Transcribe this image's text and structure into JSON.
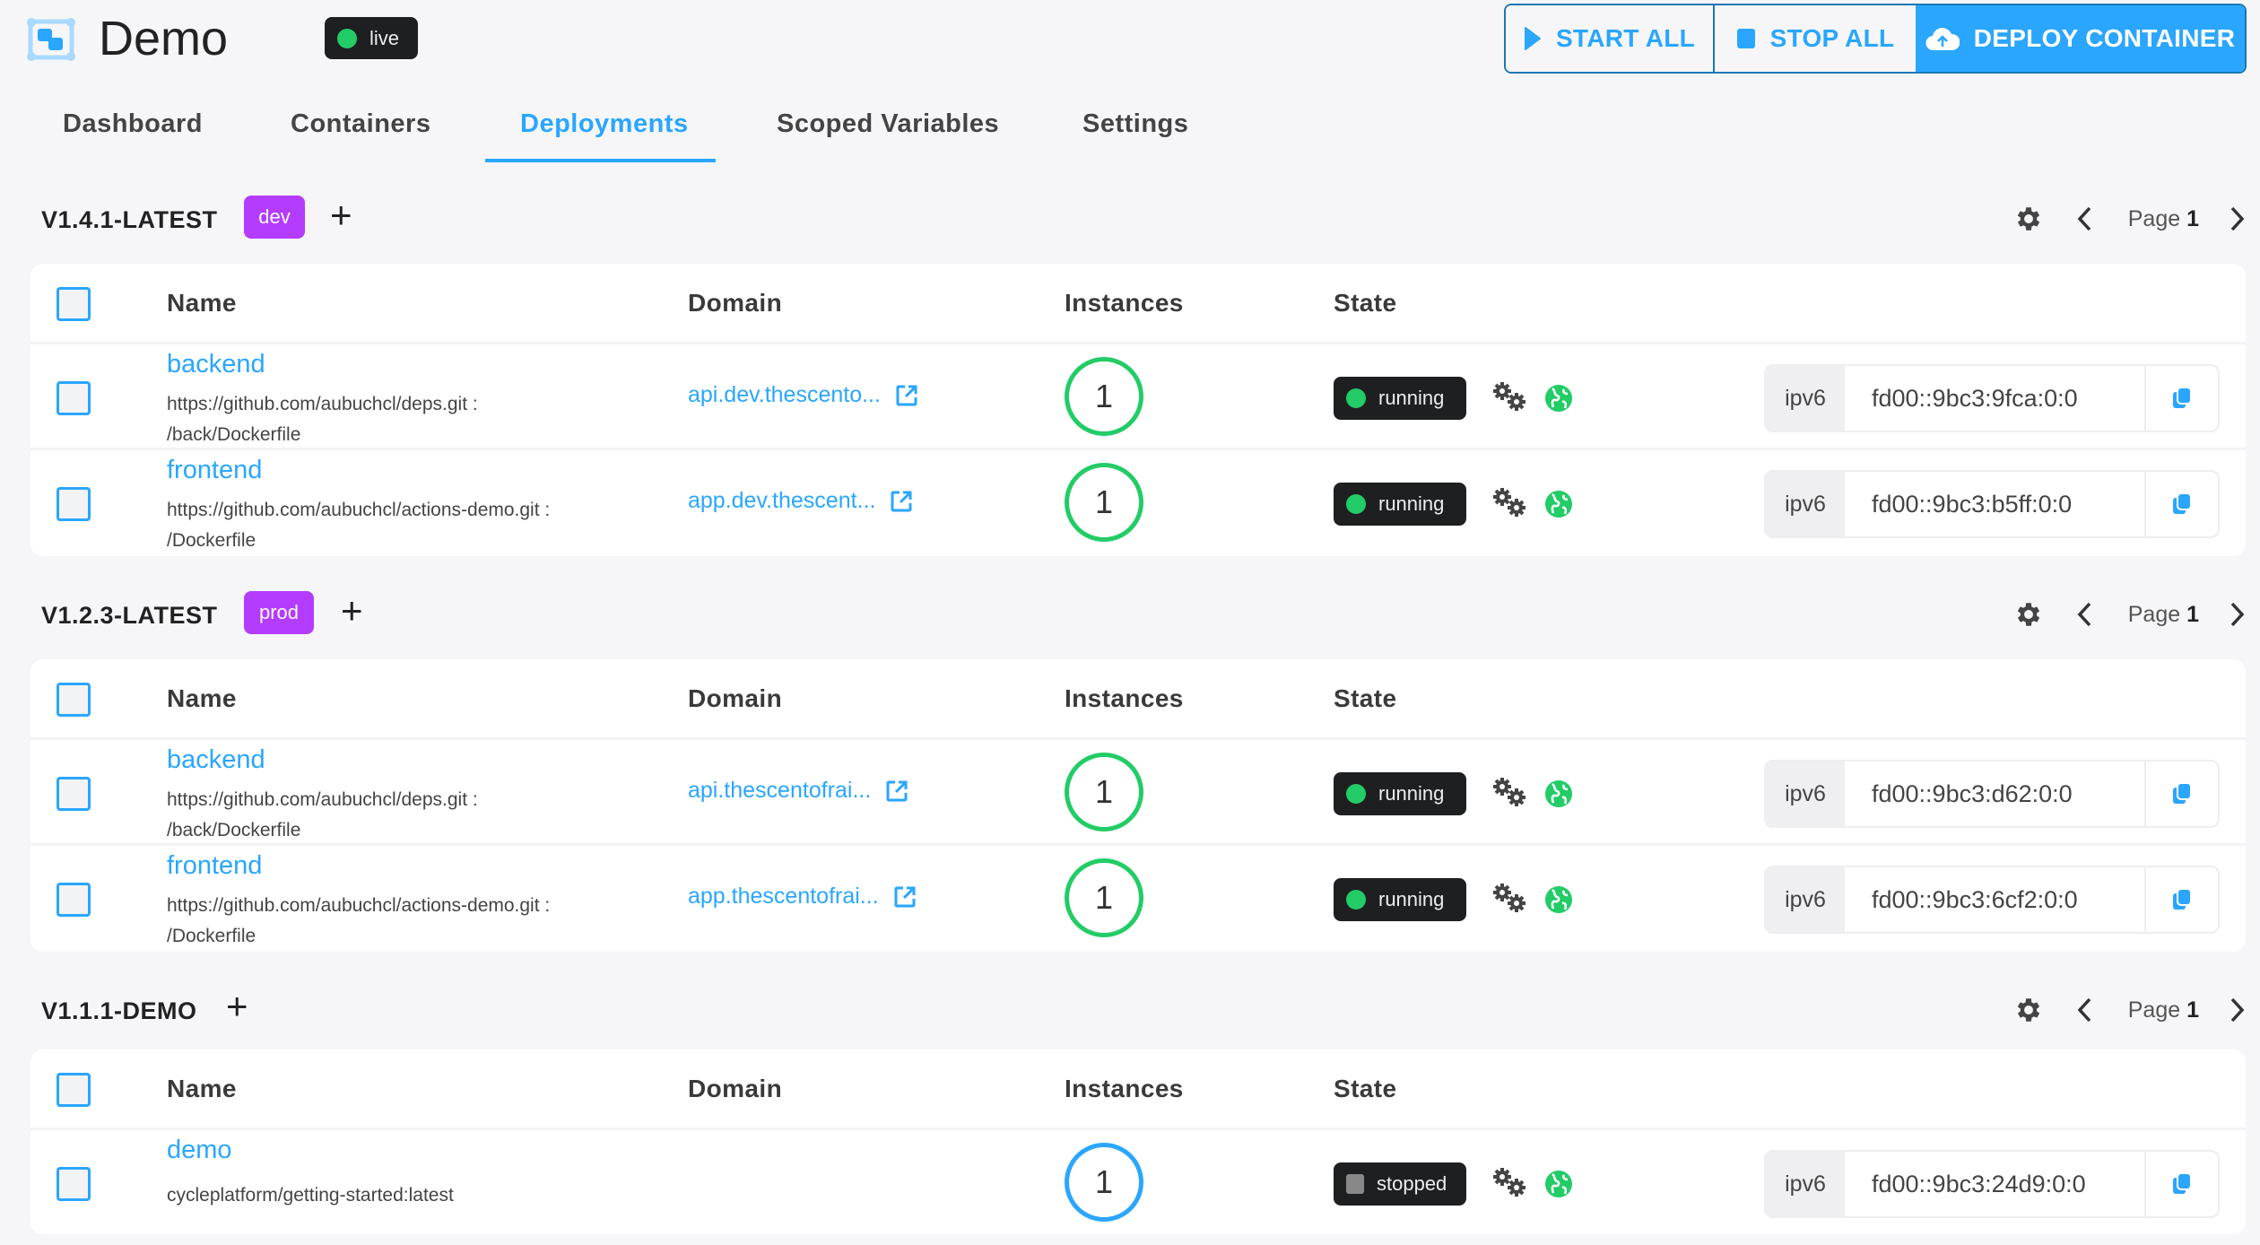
{
  "header": {
    "title": "Demo",
    "status": "live",
    "buttons": {
      "start_all": "START ALL",
      "stop_all": "STOP ALL",
      "deploy": "DEPLOY CONTAINER"
    }
  },
  "colors": {
    "accent": "#2aa6ff",
    "running": "#22cc66",
    "tag": "#b43cff",
    "badge_bg": "#1e1f21"
  },
  "tabs": [
    {
      "label": "Dashboard",
      "active": false
    },
    {
      "label": "Containers",
      "active": false
    },
    {
      "label": "Deployments",
      "active": true
    },
    {
      "label": "Scoped Variables",
      "active": false
    },
    {
      "label": "Settings",
      "active": false
    }
  ],
  "columns": {
    "name": "Name",
    "domain": "Domain",
    "instances": "Instances",
    "state": "State"
  },
  "page_prefix": "Page",
  "deployments": [
    {
      "version": "V1.4.1-LATEST",
      "tag": "dev",
      "page": "1",
      "rows": [
        {
          "name": "backend",
          "source_line1": "https://github.com/aubuchcl/deps.git :",
          "source_line2": "/back/Dockerfile",
          "domain": "api.dev.thescento...",
          "instances": "1",
          "state": "running",
          "ip_label": "ipv6",
          "ip": "fd00::9bc3:9fca:0:0"
        },
        {
          "name": "frontend",
          "source_line1": "https://github.com/aubuchcl/actions-demo.git :",
          "source_line2": "/Dockerfile",
          "domain": "app.dev.thescent...",
          "instances": "1",
          "state": "running",
          "ip_label": "ipv6",
          "ip": "fd00::9bc3:b5ff:0:0"
        }
      ]
    },
    {
      "version": "V1.2.3-LATEST",
      "tag": "prod",
      "page": "1",
      "rows": [
        {
          "name": "backend",
          "source_line1": "https://github.com/aubuchcl/deps.git :",
          "source_line2": "/back/Dockerfile",
          "domain": "api.thescentofrai...",
          "instances": "1",
          "state": "running",
          "ip_label": "ipv6",
          "ip": "fd00::9bc3:d62:0:0"
        },
        {
          "name": "frontend",
          "source_line1": "https://github.com/aubuchcl/actions-demo.git :",
          "source_line2": "/Dockerfile",
          "domain": "app.thescentofrai...",
          "instances": "1",
          "state": "running",
          "ip_label": "ipv6",
          "ip": "fd00::9bc3:6cf2:0:0"
        }
      ]
    },
    {
      "version": "V1.1.1-DEMO",
      "tag": "",
      "page": "1",
      "rows": [
        {
          "name": "demo",
          "source_line1": "cycleplatform/getting-started:latest",
          "source_line2": "",
          "domain": "",
          "instances": "1",
          "state": "stopped",
          "ip_label": "ipv6",
          "ip": "fd00::9bc3:24d9:0:0"
        }
      ]
    }
  ]
}
